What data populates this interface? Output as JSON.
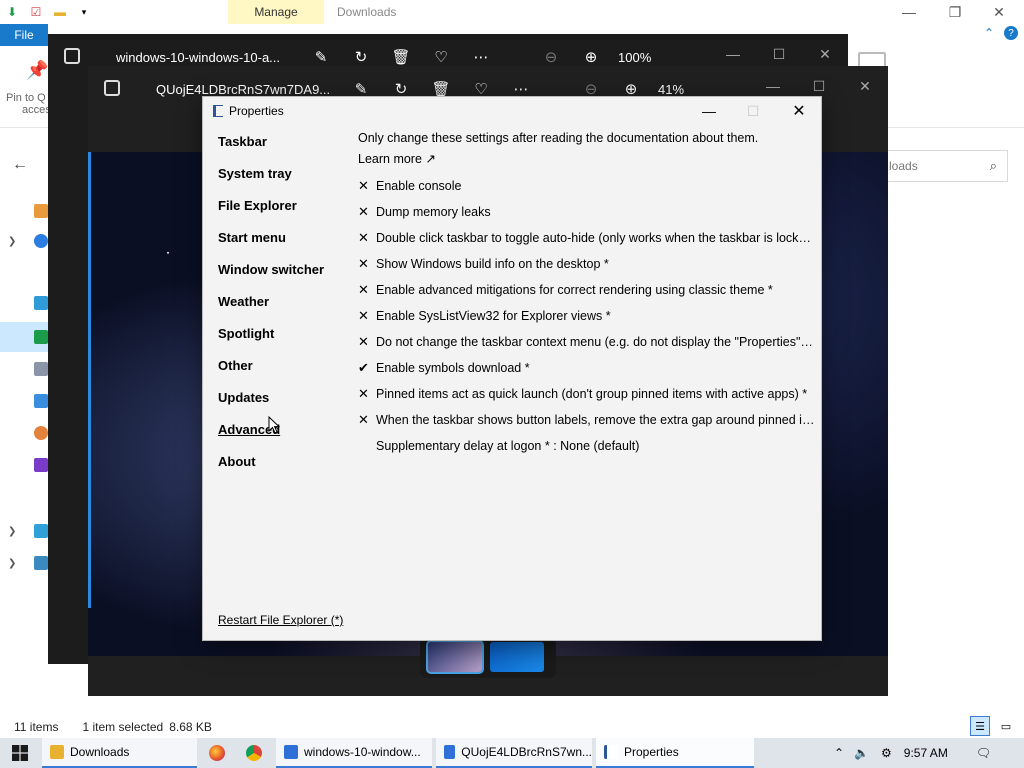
{
  "explorer": {
    "ribbon_manage": "Manage",
    "title": "Downloads",
    "file_tab": "File",
    "pin_label_line1": "Pin to Q",
    "pin_label_line2": "acces",
    "search_placeholder": "loads",
    "status_items": "11 items",
    "status_selected": "1 item selected",
    "status_size": "8.68 KB"
  },
  "photos_back": {
    "title": "windows-10-windows-10-a...",
    "zoom": "100%"
  },
  "photos_front": {
    "title": "QUojE4LDBrcRnS7wn7DA9...",
    "zoom": "41%"
  },
  "properties": {
    "title": "Properties",
    "categories": [
      "Taskbar",
      "System tray",
      "File Explorer",
      "Start menu",
      "Window switcher",
      "Weather",
      "Spotlight",
      "Other",
      "Updates",
      "Advanced",
      "About"
    ],
    "active_category": "Advanced",
    "intro": "Only change these settings after reading the documentation about them.",
    "learn_more": "Learn more ↗",
    "options": [
      {
        "mark": "✕",
        "checked": false,
        "label": "Enable console"
      },
      {
        "mark": "✕",
        "checked": false,
        "label": "Dump memory leaks"
      },
      {
        "mark": "✕",
        "checked": false,
        "label": "Double click taskbar to toggle auto-hide (only works when the taskbar is locked)"
      },
      {
        "mark": "✕",
        "checked": false,
        "label": "Show Windows build info on the desktop *"
      },
      {
        "mark": "✕",
        "checked": false,
        "label": "Enable advanced mitigations for correct rendering using classic theme *"
      },
      {
        "mark": "✕",
        "checked": false,
        "label": "Enable SysListView32 for Explorer views *"
      },
      {
        "mark": "✕",
        "checked": false,
        "label": "Do not change the taskbar context menu (e.g. do not display the \"Properties\" ite..."
      },
      {
        "mark": "✔",
        "checked": true,
        "label": "Enable symbols download *"
      },
      {
        "mark": "✕",
        "checked": false,
        "label": "Pinned items act as quick launch (don't group pinned items with active apps) *"
      },
      {
        "mark": "✕",
        "checked": false,
        "label": "When the taskbar shows button labels, remove the extra gap around pinned ite..."
      },
      {
        "mark": "",
        "checked": null,
        "label": "Supplementary delay at logon * : None (default)"
      }
    ],
    "restart_link": "Restart File Explorer (*)"
  },
  "taskbar": {
    "buttons": [
      {
        "label": "Downloads",
        "icon": "folder-icon"
      },
      {
        "label": "windows-10-window...",
        "icon": "photos-icon"
      },
      {
        "label": "QUojE4LDBrcRnS7wn...",
        "icon": "photos-icon"
      },
      {
        "label": "Properties",
        "icon": "properties-icon"
      }
    ],
    "time": "9:57 AM"
  },
  "colors": {
    "accent": "#1979ca",
    "manage_tab": "#fff7c4",
    "taskbar": "#dfe3ea",
    "dialog_bg": "#f3f3f3"
  }
}
